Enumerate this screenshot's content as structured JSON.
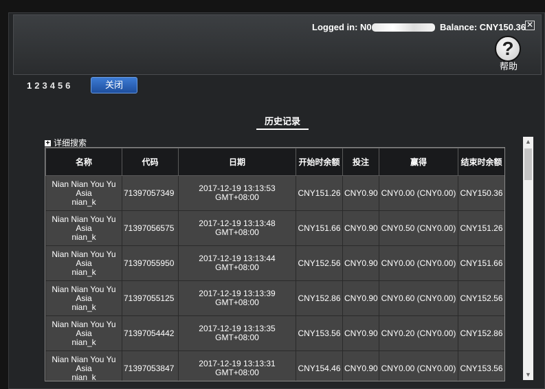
{
  "header": {
    "logged_in_label": "Logged in: N0",
    "balance": "Balance: CNY150.36",
    "close_glyph": "✕",
    "help_label": "帮助",
    "help_glyph": "?"
  },
  "pager": {
    "pages": [
      "1",
      "2",
      "3",
      "4",
      "5",
      "6"
    ],
    "current": "1",
    "close_button": "关闭"
  },
  "history": {
    "title": "历史记录",
    "advanced_search": "详细搜索",
    "plus_glyph": "+"
  },
  "table": {
    "columns": [
      "名称",
      "代码",
      "日期",
      "开始时余额",
      "投注",
      "赢得",
      "结束时余额"
    ],
    "rows": [
      {
        "name1": "Nian Nian You Yu Asia",
        "name2": "nian_k",
        "code": "71397057349",
        "date1": "2017-12-19 13:13:53",
        "date2": "GMT+08:00",
        "start": "CNY151.26",
        "bet": "CNY0.90",
        "win": "CNY0.00 (CNY0.00)",
        "end": "CNY150.36"
      },
      {
        "name1": "Nian Nian You Yu Asia",
        "name2": "nian_k",
        "code": "71397056575",
        "date1": "2017-12-19 13:13:48",
        "date2": "GMT+08:00",
        "start": "CNY151.66",
        "bet": "CNY0.90",
        "win": "CNY0.50 (CNY0.00)",
        "end": "CNY151.26"
      },
      {
        "name1": "Nian Nian You Yu Asia",
        "name2": "nian_k",
        "code": "71397055950",
        "date1": "2017-12-19 13:13:44",
        "date2": "GMT+08:00",
        "start": "CNY152.56",
        "bet": "CNY0.90",
        "win": "CNY0.00 (CNY0.00)",
        "end": "CNY151.66"
      },
      {
        "name1": "Nian Nian You Yu Asia",
        "name2": "nian_k",
        "code": "71397055125",
        "date1": "2017-12-19 13:13:39",
        "date2": "GMT+08:00",
        "start": "CNY152.86",
        "bet": "CNY0.90",
        "win": "CNY0.60 (CNY0.00)",
        "end": "CNY152.56"
      },
      {
        "name1": "Nian Nian You Yu Asia",
        "name2": "nian_k",
        "code": "71397054442",
        "date1": "2017-12-19 13:13:35",
        "date2": "GMT+08:00",
        "start": "CNY153.56",
        "bet": "CNY0.90",
        "win": "CNY0.20 (CNY0.00)",
        "end": "CNY152.86"
      },
      {
        "name1": "Nian Nian You Yu Asia",
        "name2": "nian_k",
        "code": "71397053847",
        "date1": "2017-12-19 13:13:31",
        "date2": "GMT+08:00",
        "start": "CNY154.46",
        "bet": "CNY0.90",
        "win": "CNY0.00 (CNY0.00)",
        "end": "CNY153.56"
      }
    ]
  },
  "scrollbar": {
    "up_glyph": "▲",
    "down_glyph": "▼"
  }
}
